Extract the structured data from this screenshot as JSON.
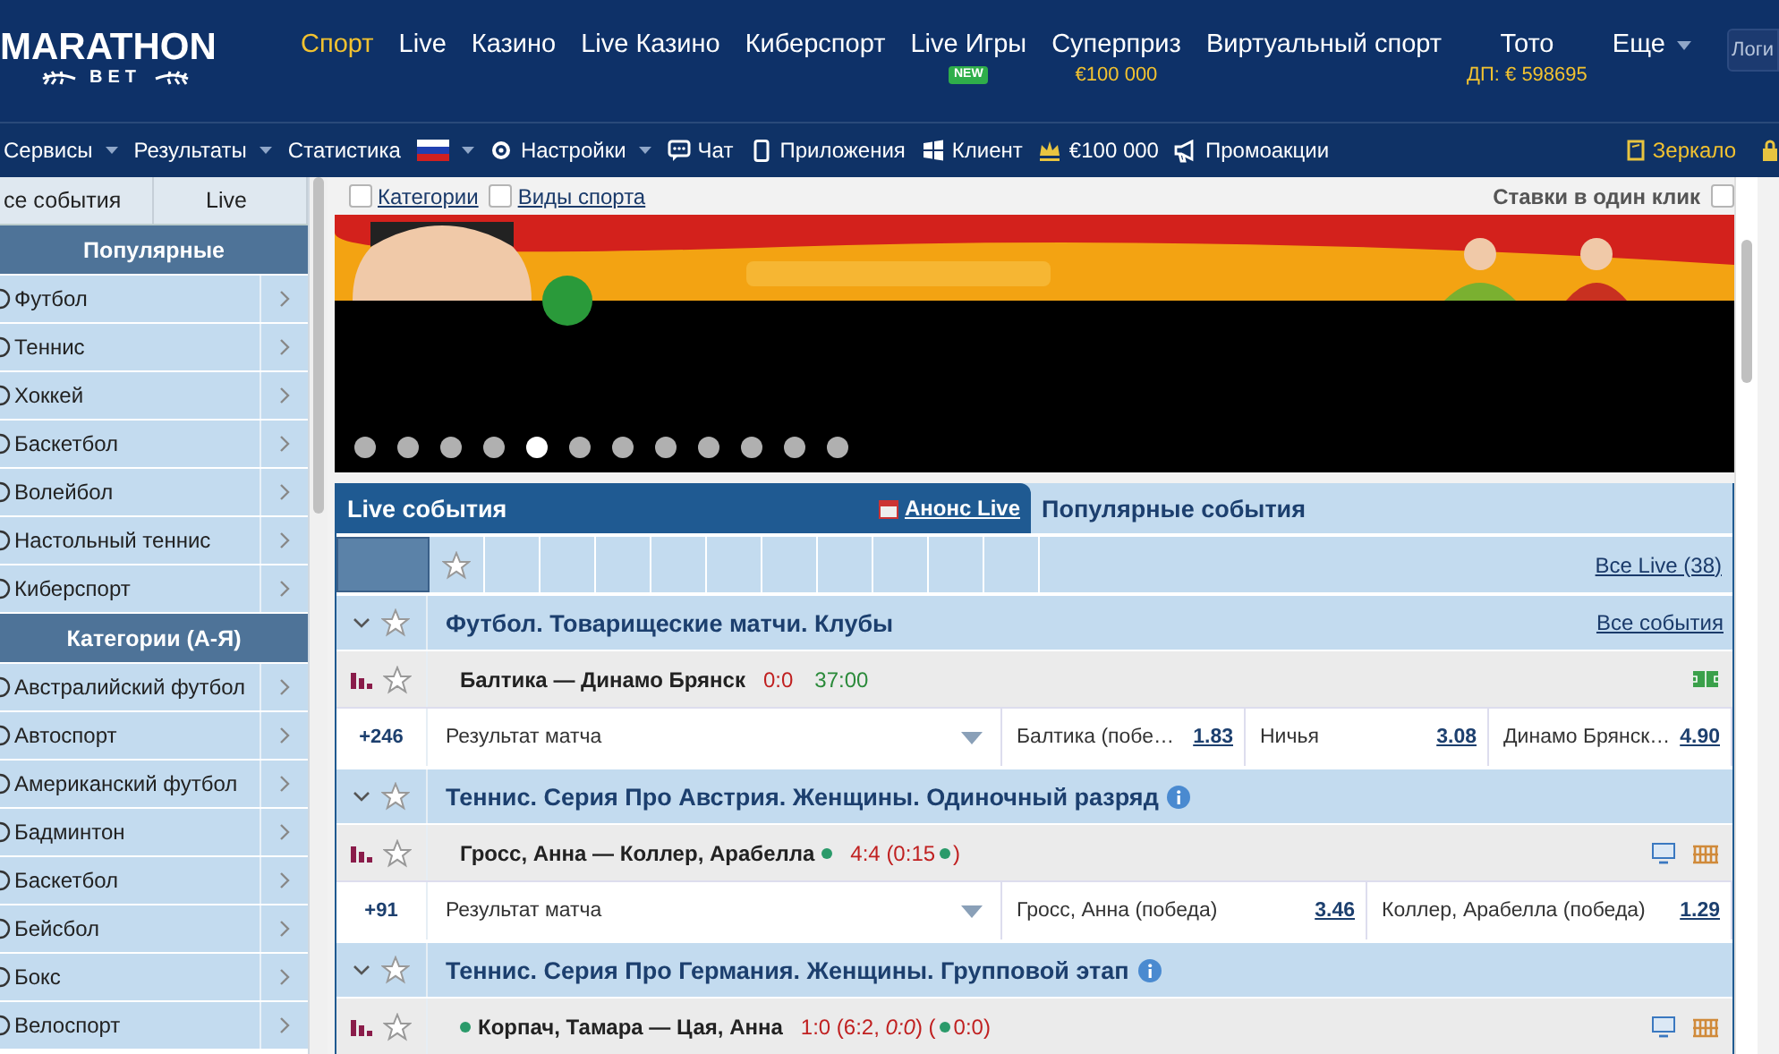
{
  "header": {
    "logo": {
      "name": "MARATHON",
      "sub": "BET"
    },
    "nav": [
      {
        "label": "Спорт",
        "selected": true
      },
      {
        "label": "Live",
        "selected": false
      },
      {
        "label": "Казино",
        "selected": false
      },
      {
        "label": "Live Казино",
        "selected": false
      },
      {
        "label": "Киберспорт",
        "selected": false
      },
      {
        "label": "Live Игры",
        "selected": false,
        "badge": "NEW"
      },
      {
        "label": "Суперприз",
        "selected": false,
        "note": "€100 000"
      },
      {
        "label": "Виртуальный спорт",
        "selected": false
      },
      {
        "label": "Тото",
        "selected": false,
        "note": "ДП: € 598695"
      },
      {
        "label": "Еще",
        "selected": false,
        "dropdown": true
      }
    ],
    "login": "Логи"
  },
  "toolbar": {
    "items": [
      {
        "kind": "menu",
        "label": "Сервисы"
      },
      {
        "kind": "menu",
        "label": "Результаты"
      },
      {
        "kind": "link",
        "label": "Статистика"
      },
      {
        "kind": "flag"
      },
      {
        "kind": "settings",
        "label": "Настройки"
      },
      {
        "kind": "chat",
        "label": "Чат"
      },
      {
        "kind": "phone",
        "label": "Приложения"
      },
      {
        "kind": "windows",
        "label": "Клиент"
      },
      {
        "kind": "prize",
        "label": "€100 000"
      },
      {
        "kind": "promo",
        "label": "Промоакции"
      }
    ],
    "mirror": "Зеркало"
  },
  "sidebar": {
    "tabs": [
      {
        "label": "се события",
        "selected": false
      },
      {
        "label": "Live",
        "selected": false
      }
    ],
    "sections": [
      {
        "title": "Популярные",
        "items": [
          "Футбол",
          "Теннис",
          "Хоккей",
          "Баскетбол",
          "Волейбол",
          "Настольный теннис",
          "Киберспорт"
        ]
      },
      {
        "title": "Категории (А-Я)",
        "items": [
          "Австралийский футбол",
          "Автоспорт",
          "Американский футбол",
          "Бадминтон",
          "Баскетбол",
          "Бейсбол",
          "Бокс",
          "Велоспорт"
        ]
      }
    ]
  },
  "filters": [
    {
      "label": "Категории",
      "checked": false
    },
    {
      "label": "Виды спорта",
      "checked": false
    }
  ],
  "one_click": {
    "label": "Ставки в один клик",
    "checked": false
  },
  "banner": {
    "kind": "picture",
    "slides": [
      {
        "selected": false
      },
      {
        "selected": false
      },
      {
        "selected": false
      },
      {
        "selected": false
      },
      {
        "selected": true
      },
      {
        "selected": false
      },
      {
        "selected": false
      },
      {
        "selected": false
      },
      {
        "selected": false
      },
      {
        "selected": false
      },
      {
        "selected": false
      },
      {
        "selected": false
      }
    ]
  },
  "events": {
    "tabs": [
      {
        "label": "Live события",
        "selected": true,
        "link": "Анонс Live"
      },
      {
        "label": "Популярные события",
        "selected": false
      }
    ],
    "all_live": "Все Live (38)",
    "groups": [
      {
        "title": "Футбол. Товарищеские матчи. Клубы",
        "info": false,
        "link": "Все события",
        "match": {
          "name": "Балтика — Динамо Брянск",
          "score": "0:0",
          "time": "37:00",
          "icons": [
            {
              "kind": "field"
            }
          ]
        },
        "market": {
          "count": "+246",
          "name": "Результат матча",
          "outcomes": [
            {
              "label": "Балтика (побе…",
              "odds": "1.83"
            },
            {
              "label": "Ничья",
              "odds": "3.08"
            },
            {
              "label": "Динамо Брянск…",
              "odds": "4.90"
            }
          ]
        }
      },
      {
        "title": "Теннис. Серия Про Австрия. Женщины. Одиночный разряд",
        "info": true,
        "match": {
          "name": "Гросс, Анна — Коллер, Арабелла",
          "serve_first": false,
          "serve_second": true,
          "score": "4:4 (0:15",
          "score_serve": true,
          "score_end": ")",
          "icons": [
            {
              "kind": "tv"
            },
            {
              "kind": "grid"
            }
          ]
        },
        "market": {
          "count": "+91",
          "name": "Результат матча",
          "outcomes": [
            {
              "label": "Гросс, Анна (победа)",
              "odds": "3.46"
            },
            {
              "label": "Коллер, Арабелла (победа)",
              "odds": "1.29"
            }
          ]
        }
      },
      {
        "title": "Теннис. Серия Про Германия. Женщины. Групповой этап",
        "info": true,
        "match": {
          "name": "Корпач, Тамара — Цая, Анна",
          "serve_first": true,
          "serve_second": false,
          "score": "1:0 (6:2, *0:0*) (",
          "score_serve": true,
          "score_end": "0:0)",
          "icons": [
            {
              "kind": "tv"
            },
            {
              "kind": "grid"
            }
          ]
        }
      }
    ]
  }
}
